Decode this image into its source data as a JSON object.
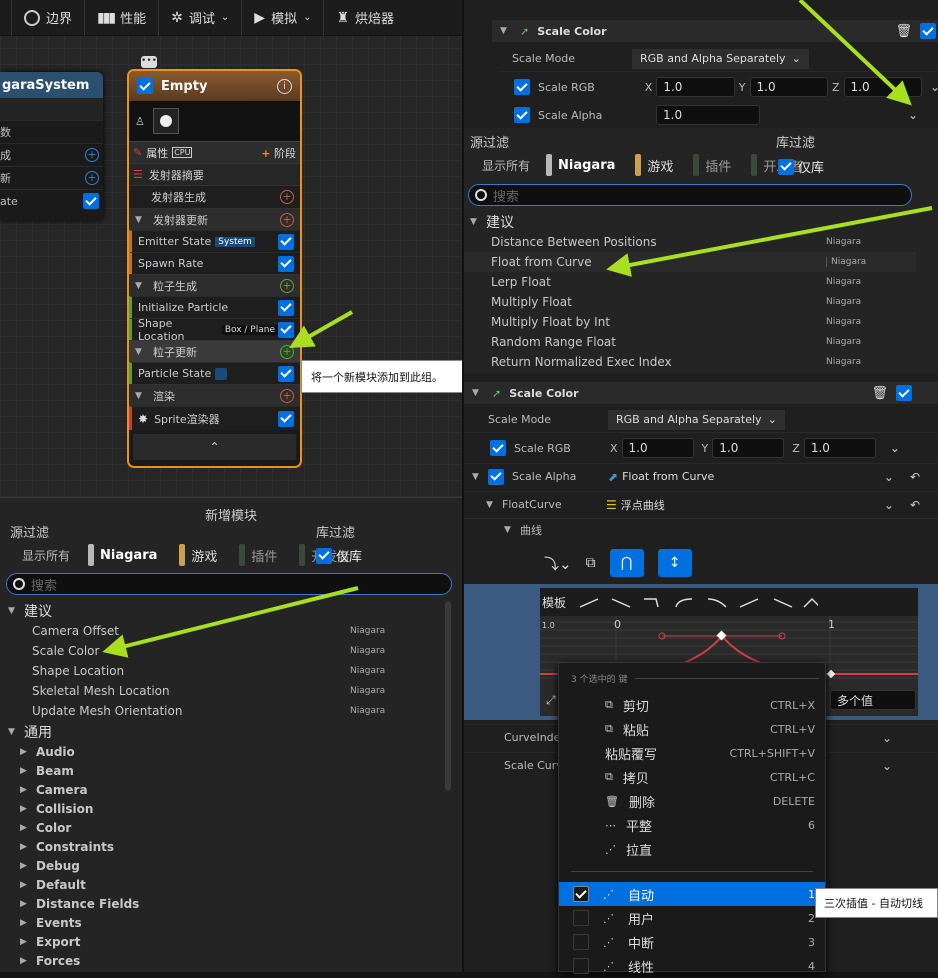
{
  "toolbar": {
    "items": [
      {
        "icon": "bounds-icon",
        "label": "边界"
      },
      {
        "icon": "performance-icon",
        "label": "性能"
      },
      {
        "icon": "debug-icon",
        "label": "调试"
      },
      {
        "icon": "simulate-icon",
        "label": "模拟"
      },
      {
        "icon": "bake-icon",
        "label": "烘焙器"
      }
    ]
  },
  "system_node": {
    "title": "garaSystem",
    "rows": [
      "数",
      "成",
      "新",
      "ate"
    ]
  },
  "emitter_node": {
    "title": "Empty",
    "properties_label": "属性",
    "cpu_label": "CPU",
    "stage_label": "阶段",
    "sections": [
      {
        "label": "发射器摘要",
        "kind": "header"
      },
      {
        "label": "发射器生成",
        "kind": "add"
      },
      {
        "label": "发射器更新",
        "kind": "group"
      },
      {
        "label": "Emitter State",
        "kind": "module",
        "badge": "System"
      },
      {
        "label": "Spawn Rate",
        "kind": "module"
      },
      {
        "label": "粒子生成",
        "kind": "group"
      },
      {
        "label": "Initialize Particle",
        "kind": "module"
      },
      {
        "label": "Shape Location",
        "kind": "module",
        "badge": "Box / Plane"
      },
      {
        "label": "粒子更新",
        "kind": "group"
      },
      {
        "label": "Particle State",
        "kind": "module"
      },
      {
        "label": "渲染",
        "kind": "group"
      },
      {
        "label": "Sprite渲染器",
        "kind": "module"
      }
    ],
    "tooltip": "将一个新模块添加到此组。"
  },
  "add_module": {
    "title": "新增模块",
    "source_filter": "源过滤",
    "library_filter": "库过滤",
    "show_all": "显示所有",
    "filters": [
      {
        "label": "Niagara",
        "color": "#b8b8b8"
      },
      {
        "label": "游戏",
        "color": "#c9a050"
      },
      {
        "label": "插件",
        "color": "#3a4a3a"
      },
      {
        "label": "开发者",
        "color": "#3a4a3a"
      }
    ],
    "library_only": "仅库",
    "search_placeholder": "搜索",
    "suggested": "建议",
    "suggestions": [
      {
        "name": "Camera Offset",
        "source": "Niagara"
      },
      {
        "name": "Scale Color",
        "source": "Niagara"
      },
      {
        "name": "Shape Location",
        "source": "Niagara"
      },
      {
        "name": "Skeletal Mesh Location",
        "source": "Niagara"
      },
      {
        "name": "Update Mesh Orientation",
        "source": "Niagara"
      }
    ],
    "general": "通用",
    "categories": [
      "Audio",
      "Beam",
      "Camera",
      "Collision",
      "Color",
      "Constraints",
      "Debug",
      "Default",
      "Distance Fields",
      "Events",
      "Export",
      "Forces"
    ]
  },
  "scale_color_top": {
    "title": "Scale Color",
    "scale_mode_label": "Scale Mode",
    "scale_mode_value": "RGB and Alpha Separately",
    "scale_rgb_label": "Scale RGB",
    "x": "1.0",
    "y": "1.0",
    "z": "1.0",
    "scale_alpha_label": "Scale Alpha",
    "alpha": "1.0"
  },
  "float_picker": {
    "source_filter": "源过滤",
    "library_filter": "库过滤",
    "show_all": "显示所有",
    "filters": [
      {
        "label": "Niagara",
        "color": "#b8b8b8"
      },
      {
        "label": "游戏",
        "color": "#c9a050"
      },
      {
        "label": "插件",
        "color": "#3a4a3a"
      },
      {
        "label": "开发者",
        "color": "#3a4a3a"
      }
    ],
    "library_only": "仅库",
    "search_placeholder": "搜索",
    "suggested": "建议",
    "items": [
      {
        "name": "Distance Between Positions",
        "source": "Niagara"
      },
      {
        "name": "Float from Curve",
        "source": "Niagara"
      },
      {
        "name": "Lerp Float",
        "source": "Niagara"
      },
      {
        "name": "Multiply Float",
        "source": "Niagara"
      },
      {
        "name": "Multiply Float by Int",
        "source": "Niagara"
      },
      {
        "name": "Random Range Float",
        "source": "Niagara"
      },
      {
        "name": "Return Normalized Exec Index",
        "source": "Niagara"
      }
    ]
  },
  "scale_color_bottom": {
    "title": "Scale Color",
    "scale_mode_label": "Scale Mode",
    "scale_mode_value": "RGB and Alpha Separately",
    "scale_rgb_label": "Scale RGB",
    "x_label": "X",
    "y_label": "Y",
    "z_label": "Z",
    "x": "1.0",
    "y": "1.0",
    "z": "1.0",
    "scale_alpha_label": "Scale Alpha",
    "alpha_value": "Float from Curve",
    "float_curve_label": "FloatCurve",
    "float_curve_value": "浮点曲线",
    "curve_label": "曲线",
    "template_label": "模板",
    "multi_value": "多个值",
    "curve_index_label": "CurveIndex",
    "scale_curve_label": "Scale Curve",
    "tick_0": "0",
    "tick_1": "1",
    "y_tick": "1.0"
  },
  "context_menu": {
    "header": "3 个选中的 键",
    "items": [
      {
        "icon": "cut-icon",
        "label": "剪切",
        "shortcut": "CTRL+X"
      },
      {
        "icon": "paste-icon",
        "label": "粘贴",
        "shortcut": "CTRL+V"
      },
      {
        "icon": "",
        "label": "粘贴覆写",
        "shortcut": "CTRL+SHIFT+V"
      },
      {
        "icon": "copy-icon",
        "label": "拷贝",
        "shortcut": "CTRL+C"
      },
      {
        "icon": "delete-icon",
        "label": "删除",
        "shortcut": "DELETE"
      },
      {
        "icon": "flatten-icon",
        "label": "平整",
        "shortcut": "6"
      },
      {
        "icon": "straighten-icon",
        "label": "拉直",
        "shortcut": ""
      }
    ],
    "interp": [
      {
        "label": "自动",
        "shortcut": "1",
        "checked": true
      },
      {
        "label": "用户",
        "shortcut": "2",
        "checked": false
      },
      {
        "label": "中断",
        "shortcut": "3",
        "checked": false
      },
      {
        "label": "线性",
        "shortcut": "4",
        "checked": false
      }
    ],
    "tooltip": "三次插值 - 自动切线"
  }
}
